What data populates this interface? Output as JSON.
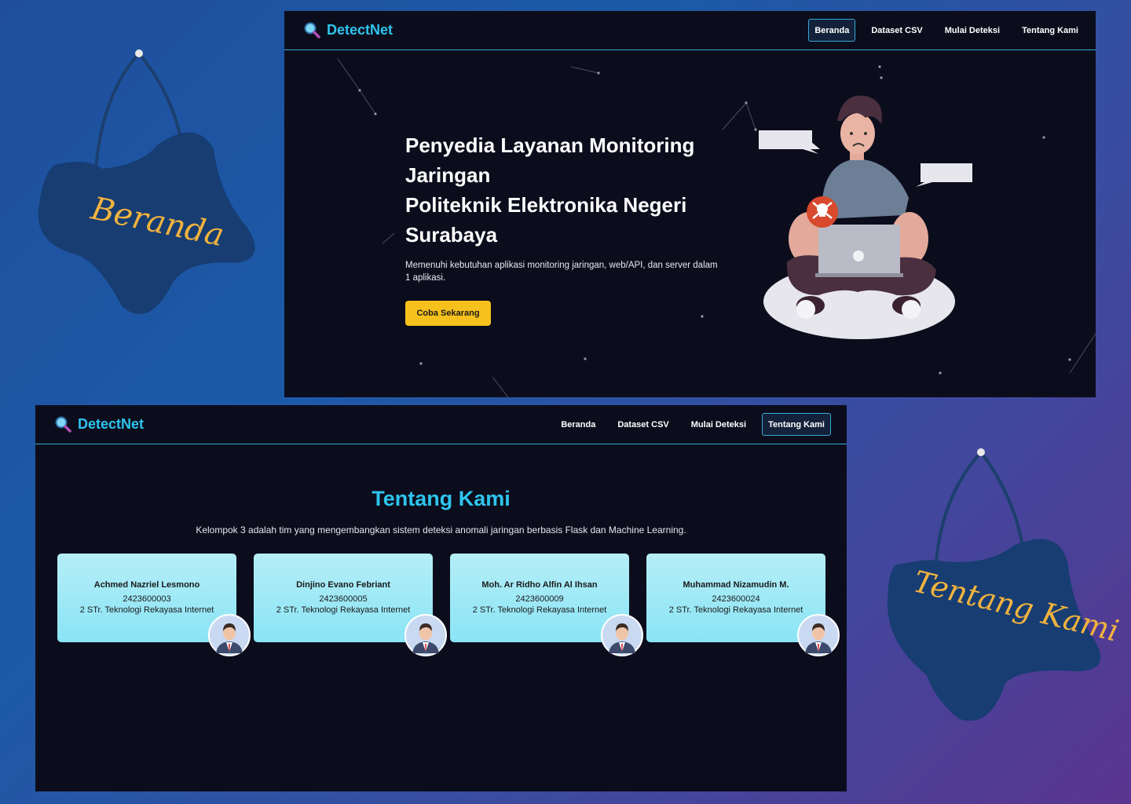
{
  "tags": {
    "beranda": "Beranda",
    "tentang": "Tentang Kami"
  },
  "brand": {
    "name": "DetectNet"
  },
  "nav": {
    "items": [
      "Beranda",
      "Dataset CSV",
      "Mulai Deteksi",
      "Tentang Kami"
    ]
  },
  "hero": {
    "title_lines": [
      "Penyedia Layanan Monitoring",
      "Jaringan",
      "Politeknik Elektronika Negeri",
      "Surabaya"
    ],
    "subtitle": "Memenuhi kebutuhan aplikasi monitoring jaringan, web/API, dan server dalam 1 aplikasi.",
    "button": "Coba Sekarang"
  },
  "about": {
    "title": "Tentang Kami",
    "description": "Kelompok 3 adalah tim yang mengembangkan sistem deteksi anomali jaringan berbasis Flask dan Machine Learning.",
    "members": [
      {
        "name": "Achmed Nazriel Lesmono",
        "nim": "2423600003",
        "program": "2 STr. Teknologi Rekayasa Internet"
      },
      {
        "name": "Dinjino Evano Febriant",
        "nim": "2423600005",
        "program": "2 STr. Teknologi Rekayasa Internet"
      },
      {
        "name": "Moh. Ar Ridho Alfin Al Ihsan",
        "nim": "2423600009",
        "program": "2 STr. Teknologi Rekayasa Internet"
      },
      {
        "name": "Muhammad Nizamudin M.",
        "nim": "2423600024",
        "program": "2 STr. Teknologi Rekayasa Internet"
      }
    ]
  },
  "colors": {
    "accent": "#2ec4ee",
    "button": "#f7c11d",
    "window_bg": "#0c0d1c",
    "card": "#8ae4f5",
    "tag_text": "#f2b33d",
    "tag_blob": "#1a3f72"
  },
  "icons": {
    "brand": "magnifier-icon",
    "avatar": "user-avatar-icon"
  }
}
